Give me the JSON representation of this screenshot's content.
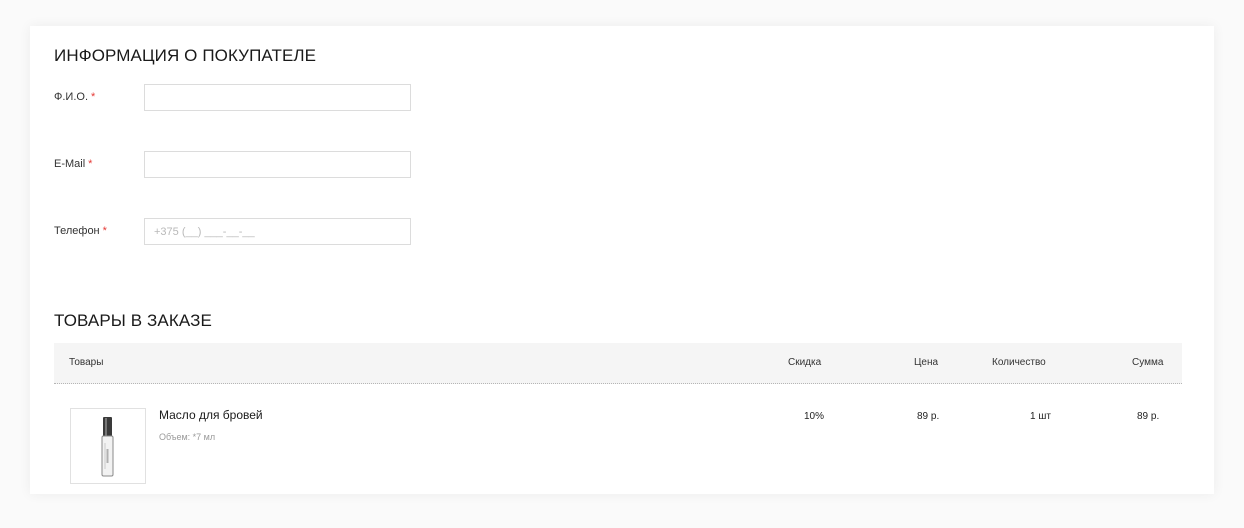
{
  "customer": {
    "title": "ИНФОРМАЦИЯ О ПОКУПАТЕЛЕ",
    "required_mark": "*",
    "fields": [
      {
        "label": "Ф.И.О.",
        "value": "",
        "placeholder": ""
      },
      {
        "label": "E-Mail",
        "value": "",
        "placeholder": ""
      },
      {
        "label": "Телефон",
        "value": "",
        "placeholder": "+375 (__) ___-__-__"
      }
    ]
  },
  "order": {
    "title": "ТОВАРЫ В ЗАКАЗЕ",
    "columns": {
      "product": "Товары",
      "discount": "Скидка",
      "price": "Цена",
      "quantity": "Количество",
      "sum": "Сумма"
    },
    "items": [
      {
        "name": "Масло для бровей",
        "volume": "Объем: *7 мл",
        "discount": "10%",
        "price": "89 р.",
        "quantity": "1 шт",
        "sum": "89 р.",
        "image_icon": "oil-bottle-icon"
      }
    ]
  },
  "colors": {
    "required": "#e53935",
    "header_bg": "#f5f5f5",
    "border": "#dcdcdc"
  }
}
